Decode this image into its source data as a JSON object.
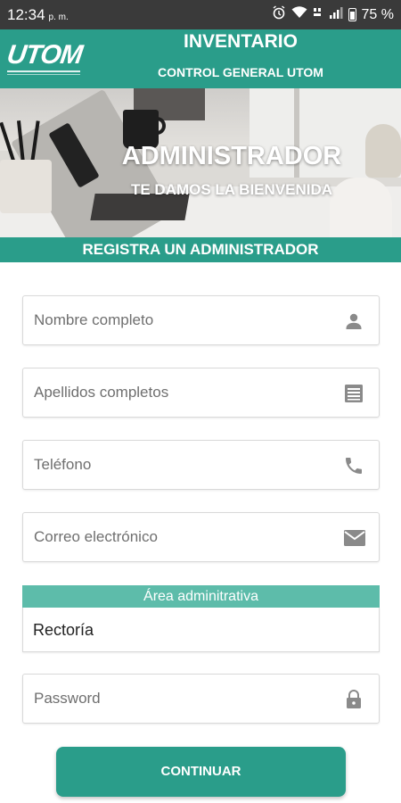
{
  "status_bar": {
    "time": "12:34",
    "ampm": "p. m.",
    "battery_percent": "75 %",
    "icons": [
      "alarm-icon",
      "wifi-icon",
      "volte-icon",
      "signal-icon",
      "battery-icon"
    ]
  },
  "header": {
    "logo_text": "UTOM",
    "title": "INVENTARIO",
    "subtitle": "CONTROL GENERAL UTOM",
    "bg_color": "#2a9d8a"
  },
  "hero": {
    "title": "ADMINISTRADOR",
    "subtitle": "TE DAMOS LA BIENVENIDA"
  },
  "section": {
    "title": "REGISTRA UN ADMINISTRADOR"
  },
  "form": {
    "nombre": {
      "placeholder": "Nombre completo",
      "icon": "person-icon"
    },
    "apellidos": {
      "placeholder": "Apellidos completos",
      "icon": "list-icon"
    },
    "telefono": {
      "placeholder": "Teléfono",
      "icon": "phone-icon"
    },
    "correo": {
      "placeholder": "Correo electrónico",
      "icon": "mail-icon"
    },
    "area": {
      "label": "Área adminitrativa",
      "selected": "Rectoría"
    },
    "password": {
      "placeholder": "Password",
      "icon": "lock-icon"
    },
    "submit_label": "CONTINUAR"
  }
}
